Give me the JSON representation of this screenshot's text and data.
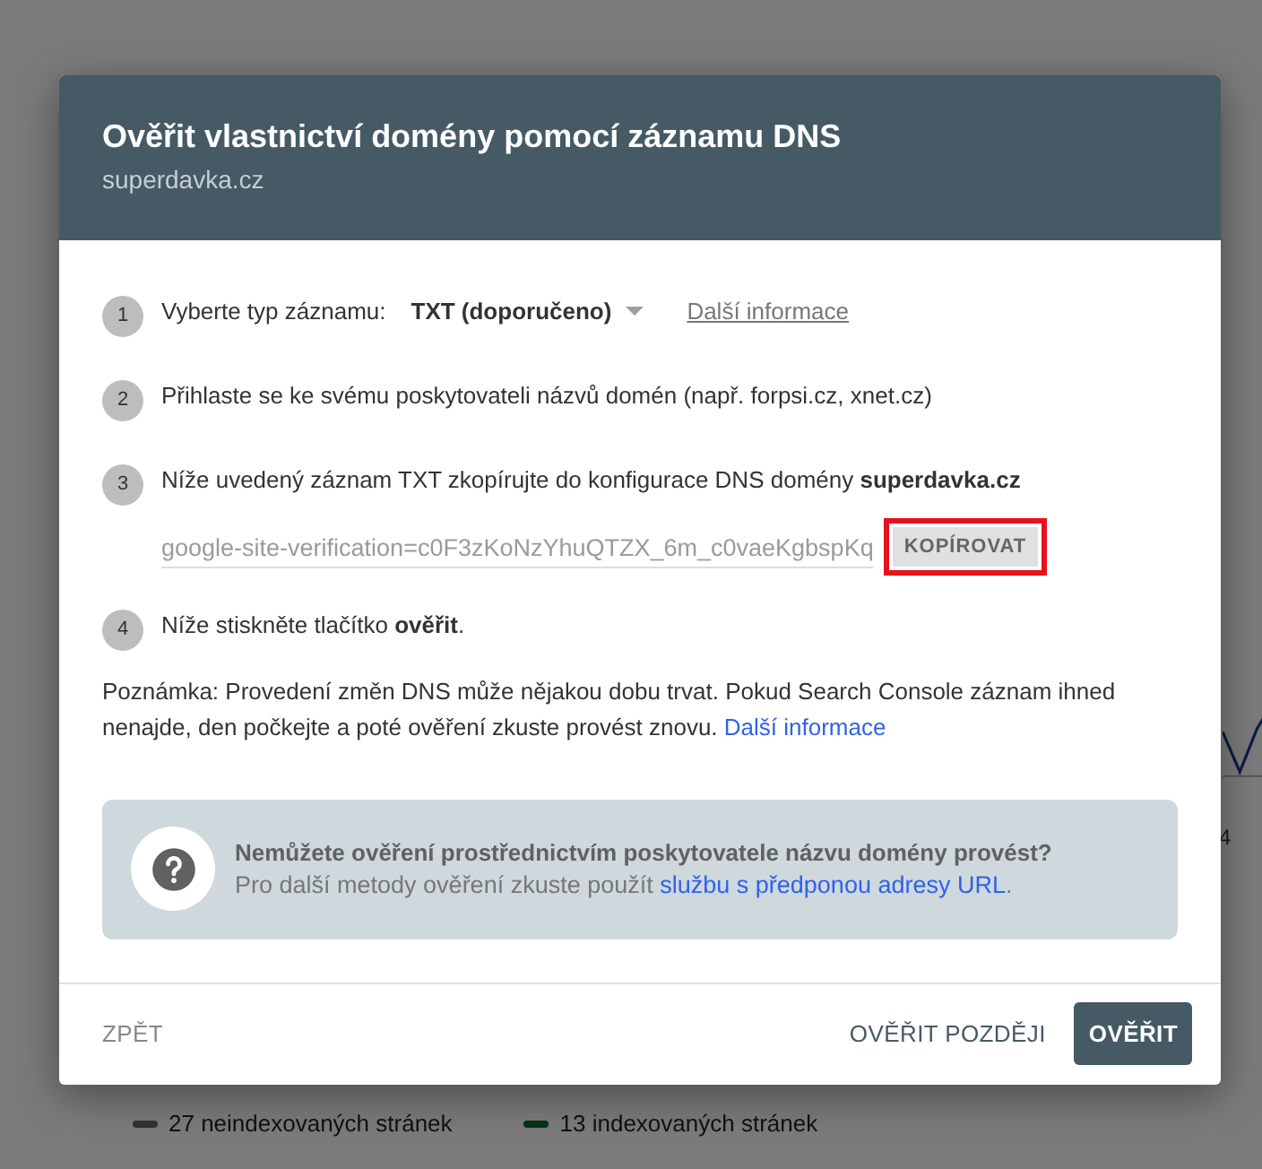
{
  "background": {
    "axis_label": "4",
    "legend": [
      {
        "label": "27 neindexovaných stránek",
        "color": "#303234"
      },
      {
        "label": "13 indexovaných stránek",
        "color": "#073318"
      }
    ]
  },
  "dialog": {
    "title": "Ověřit vlastnictví domény pomocí záznamu DNS",
    "subtitle": "superdavka.cz",
    "steps": [
      {
        "kind": "select",
        "number": "1",
        "label": "Vyberte typ záznamu:",
        "value": "TXT (doporučeno)",
        "link": "Další informace"
      },
      {
        "kind": "text",
        "number": "2",
        "text": "Přihlaste se ke svému poskytovateli názvů domén (např. forpsi.cz, xnet.cz)"
      },
      {
        "kind": "text",
        "number": "3",
        "text": "Níže uvedený záznam TXT zkopírujte do konfigurace DNS domény **superdavka.cz**",
        "record": "google-site-verification=c0F3zKoNzYhuQTZX_6m_c0vaeKgbspKq",
        "copy": "KOPÍROVAT"
      },
      {
        "kind": "text",
        "number": "4",
        "text": "Níže stiskněte tlačítko **ověřit**."
      }
    ],
    "note": "Poznámka: Provedení změn DNS může nějakou dobu trvat. Pokud Search Console záznam ihned nenajde, den počkejte a poté ověření zkuste provést znovu.",
    "note_link": "Další informace",
    "help": {
      "title": "Nemůžete ověření prostřednictvím poskytovatele názvu domény provést?",
      "text": "Pro další metody ověření zkuste použít",
      "link": "službu s předponou adresy URL",
      "after": "."
    },
    "buttons": [
      {
        "label": "ZPĚT",
        "kind": "text"
      },
      {
        "label": "OVĚŘIT POZDĚJI",
        "kind": "secondary"
      },
      {
        "label": "OVĚŘIT",
        "kind": "primary"
      }
    ]
  }
}
